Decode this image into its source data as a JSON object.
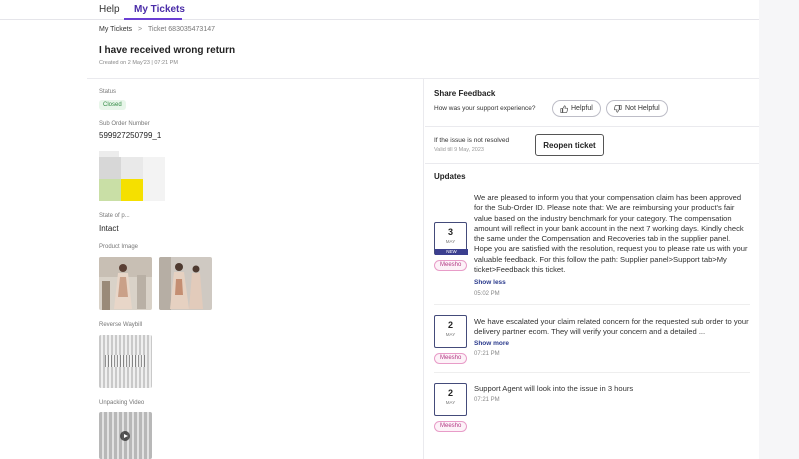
{
  "tabs": {
    "help": "Help",
    "my_tickets": "My Tickets"
  },
  "breadcrumb": {
    "root": "My Tickets",
    "separator": ">",
    "current": "Ticket 683035473147"
  },
  "ticket": {
    "title": "I have received wrong return",
    "created": "Created on 2 May'23 | 07:21 PM"
  },
  "details": {
    "status_label": "Status",
    "status_value": "Closed",
    "sub_order_label": "Sub Order Number",
    "sub_order_value": "599927250799_1",
    "state_label": "State of p...",
    "state_value": "Intact",
    "product_image_label": "Product Image",
    "reverse_waybill_label": "Reverse Waybill",
    "unpacking_video_label": "Unpacking Video"
  },
  "feedback": {
    "title": "Share Feedback",
    "question": "How was your support experience?",
    "helpful": "Helpful",
    "not_helpful": "Not Helpful"
  },
  "reopen": {
    "text": "If the issue is not resolved",
    "date": "Valid till 9 May, 2023",
    "button": "Reopen ticket"
  },
  "updates": {
    "title": "Updates",
    "items": [
      {
        "day": "3",
        "month": "MAY",
        "new": "NEW",
        "source": "Meesho",
        "message": "We are pleased to inform you that your compensation claim has been approved for the Sub-Order ID. Please note that: We are reimbursing your product's fair value based on the industry benchmark for your category. The compensation amount will reflect in your bank account in the next 7 working days. Kindly check the same under the Compensation and Recoveries tab in the supplier panel. Hope you are satisfied with the resolution, request you to please rate us with your valuable feedback. For this follow the path: Supplier panel>Support tab>My ticket>Feedback this ticket.",
        "link": "Show less",
        "time": "05:02 PM"
      },
      {
        "day": "2",
        "month": "MAY",
        "source": "Meesho",
        "message": "We have escalated your claim related concern for the requested sub order to your delivery partner ecom. They will verify your concern and a detailed ...",
        "link": "Show more",
        "time": "07:21 PM"
      },
      {
        "day": "2",
        "month": "MAY",
        "source": "Meesho",
        "message": "Support Agent will look into the issue in 3 hours",
        "time": "07:21 PM"
      }
    ]
  },
  "icons": {
    "helpful": "thumbs-up-icon",
    "not_helpful": "thumbs-down-icon",
    "play": "play-icon",
    "breadcrumb": "chevron-right-icon"
  },
  "colors": {
    "accent": "#6a3fd4",
    "status_green": "#2f8a42",
    "meesho_pink": "#b23a84",
    "date_border": "#444b7a"
  }
}
